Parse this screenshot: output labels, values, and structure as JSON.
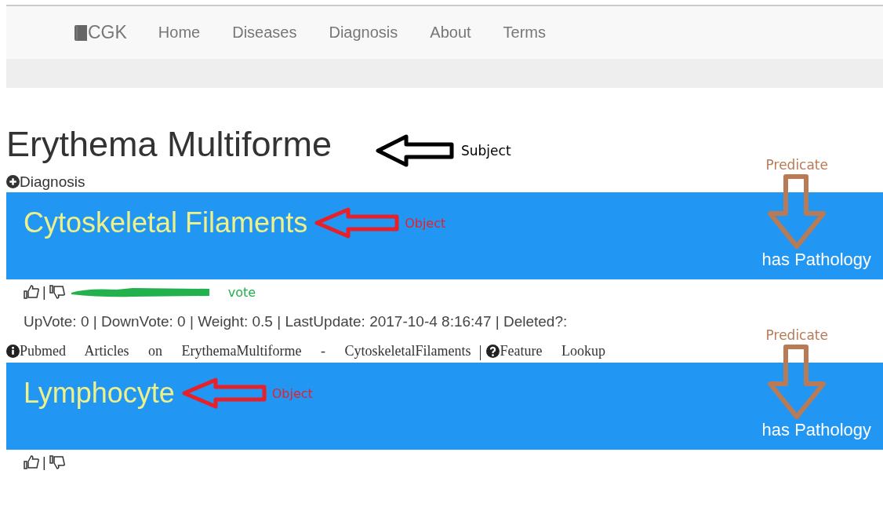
{
  "nav": {
    "brand": "CGK",
    "items": [
      "Home",
      "Diseases",
      "Diagnosis",
      "About",
      "Terms"
    ]
  },
  "title": {
    "text": "Erythema Multiforme",
    "annotation": {
      "label": "Subject",
      "color": "#000000"
    }
  },
  "section": "Diagnosis",
  "cards": [
    {
      "object": "Cytoskeletal Filaments",
      "object_annotation": {
        "label": "Object",
        "color": "#e8202a"
      },
      "predicate": "has Pathology",
      "predicate_annotation": {
        "label": "Predicate",
        "color": "#b97a56"
      },
      "vote_separator": "|",
      "vote_annotation": {
        "label": "vote",
        "color": "#22b14c"
      },
      "stats": "UpVote: 0 | DownVote: 0 | Weight: 0.5 | LastUpdate: 2017-10-4 8:16:47 | Deleted?:",
      "links": {
        "pubmed": "Pubmed Articles on ErythemaMultiforme - CytoskeletalFilaments",
        "separator": "|",
        "feature": "Feature Lookup"
      }
    },
    {
      "object": "Lymphocyte",
      "object_annotation": {
        "label": "Object",
        "color": "#e8202a"
      },
      "predicate": "has Pathology",
      "predicate_annotation": {
        "label": "Predicate",
        "color": "#b97a56"
      },
      "vote_separator": "|"
    }
  ]
}
